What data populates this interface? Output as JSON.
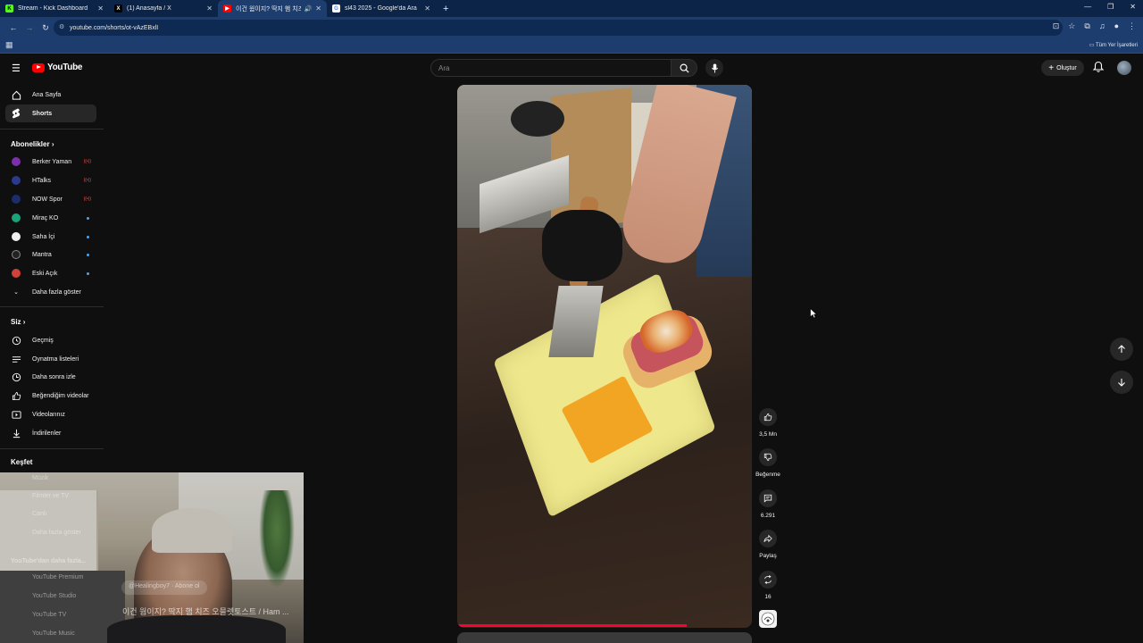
{
  "browser": {
    "tabs": [
      {
        "title": "Stream - Kick Dashboard",
        "favicon": "K",
        "color": "#53fc18"
      },
      {
        "title": "(1) Anasayfa / X",
        "favicon": "X",
        "color": "#000000"
      },
      {
        "title": "이건 웜이지? 딱지 햄 치즈",
        "favicon": "▶",
        "color": "#ff0000",
        "active": true
      },
      {
        "title": "sl43 2025 - Google'da Ara",
        "favicon": "G",
        "color": "#4285f4"
      }
    ],
    "url": "youtube.com/shorts/ot-vAzEBxlI",
    "bookmarks_all": "Tüm Yer İşaretleri"
  },
  "header": {
    "logo_text": "YouTube",
    "search_placeholder": "Ara",
    "create_label": "Oluştur"
  },
  "sidebar": {
    "main": [
      {
        "label": "Ana Sayfa",
        "icon": "home-icon"
      },
      {
        "label": "Shorts",
        "icon": "shorts-icon",
        "active": true
      }
    ],
    "subscriptions_title": "Abonelikler",
    "subscriptions": [
      {
        "label": "Berker Yaman",
        "color": "#7b2fa8",
        "status": "live"
      },
      {
        "label": "HTalks",
        "color": "#2b3a8c",
        "status": "live"
      },
      {
        "label": "NOW Spor",
        "color": "#1b2d6b",
        "status": "live"
      },
      {
        "label": "Miraç KO",
        "color": "#1aa37a",
        "status": "dot"
      },
      {
        "label": "Saha İçi",
        "color": "#f1f1f1",
        "status": "dot"
      },
      {
        "label": "Mantra",
        "color": "#222222",
        "status": "dot"
      },
      {
        "label": "Eski Açık",
        "color": "#d0413b",
        "status": "dot"
      }
    ],
    "show_more": "Daha fazla göster",
    "you_title": "Siz",
    "you": [
      {
        "label": "Geçmiş",
        "icon": "history-icon"
      },
      {
        "label": "Oynatma listeleri",
        "icon": "playlist-icon"
      },
      {
        "label": "Daha sonra izle",
        "icon": "watch-later-icon"
      },
      {
        "label": "Beğendiğim videolar",
        "icon": "liked-icon"
      },
      {
        "label": "Videolarınız",
        "icon": "your-videos-icon"
      },
      {
        "label": "İndirilenler",
        "icon": "download-icon"
      }
    ],
    "explore_title": "Keşfet",
    "explore_faded": [
      "Müzik",
      "Filmler ve TV",
      "Canlı",
      "Daha fazla göster"
    ],
    "more_from_title": "YouTube'dan daha fazla...",
    "more_from": [
      "YouTube Premium",
      "YouTube Studio",
      "YouTube TV",
      "YouTube Music"
    ]
  },
  "overlay": {
    "chip_text": "@Healingboy7 · Abone ol",
    "caption": "이건 웜이지? 딱지 햄 치즈 오믈렛토스트 / Ham ..."
  },
  "actions": {
    "likes": "3,5 Mn",
    "dislike_label": "Beğenme",
    "comments": "6.291",
    "share_label": "Paylaş",
    "remix_count": "16"
  },
  "video": {
    "progress": 0.78
  }
}
